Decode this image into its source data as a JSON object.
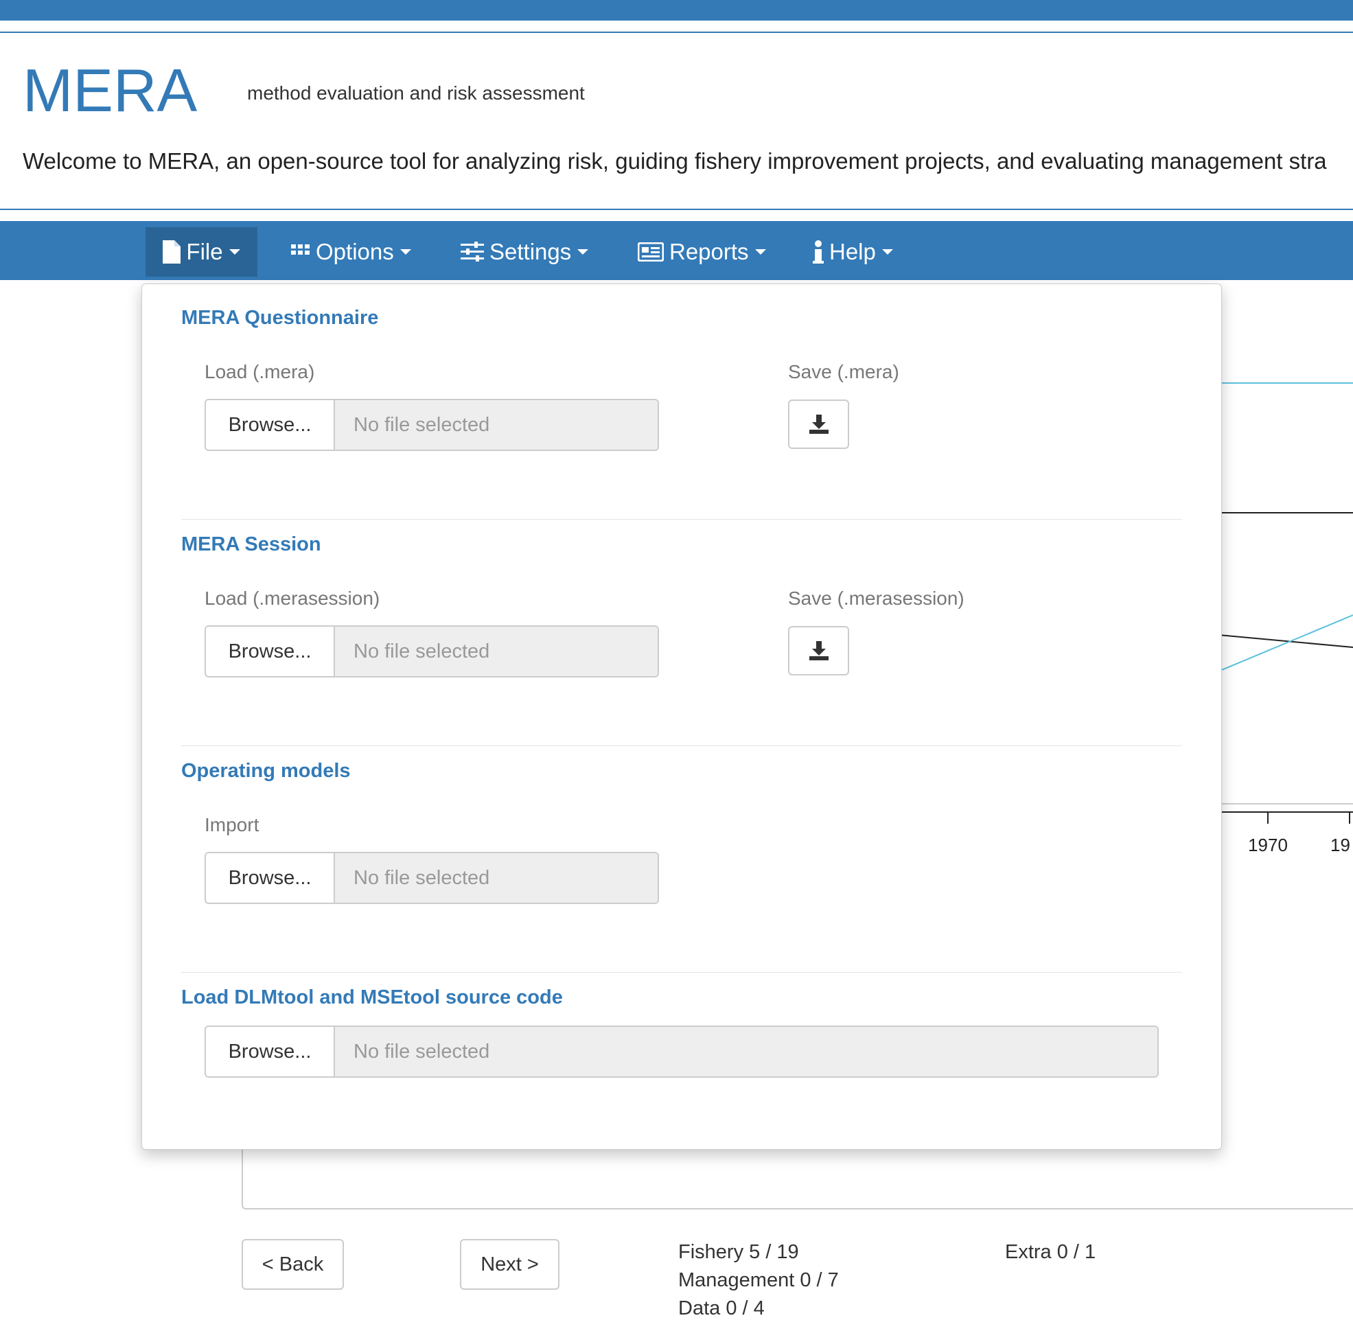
{
  "header": {
    "title": "MERA",
    "subtitle": "method evaluation and risk assessment",
    "welcome": "Welcome to MERA, an open-source tool for analyzing risk, guiding fishery improvement projects, and evaluating management stra"
  },
  "navbar": {
    "items": [
      {
        "label": "File",
        "icon": "file-icon",
        "active": true
      },
      {
        "label": "Options",
        "icon": "grid-icon"
      },
      {
        "label": "Settings",
        "icon": "sliders-icon"
      },
      {
        "label": "Reports",
        "icon": "newspaper-icon"
      },
      {
        "label": "Help",
        "icon": "info-icon"
      }
    ]
  },
  "file_menu": {
    "questionnaire": {
      "title": "MERA Questionnaire",
      "load_label": "Load (.mera)",
      "save_label": "Save (.mera)",
      "browse": "Browse...",
      "file": "No file selected"
    },
    "session": {
      "title": "MERA Session",
      "load_label": "Load (.merasession)",
      "save_label": "Save (.merasession)",
      "browse": "Browse...",
      "file": "No file selected"
    },
    "operating_models": {
      "title": "Operating models",
      "import_label": "Import",
      "browse": "Browse...",
      "file": "No file selected"
    },
    "source_code": {
      "title": "Load DLMtool and MSEtool source code",
      "browse": "Browse...",
      "file": "No file selected"
    }
  },
  "background": {
    "chart_ticks": [
      "1970",
      "19"
    ]
  },
  "footer": {
    "back_label": "< Back",
    "next_label": "Next >",
    "progress": {
      "fishery": "Fishery 5 / 19",
      "management": "Management 0 / 7",
      "data": "Data 0 / 4",
      "extra": "Extra 0 / 1"
    }
  },
  "colors": {
    "brand": "#337ab7",
    "active_nav": "#2a6496",
    "chart_line_blue": "#5bc0de"
  }
}
